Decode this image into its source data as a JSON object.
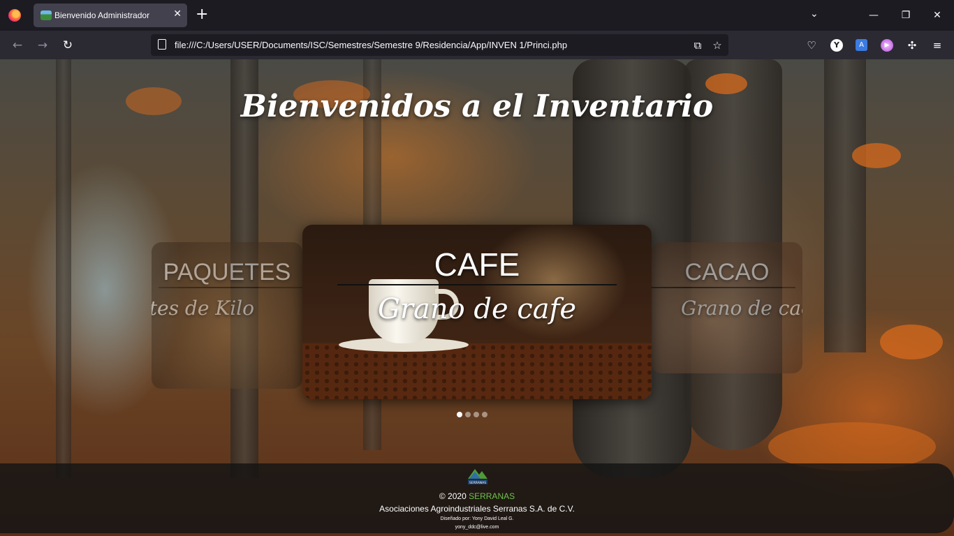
{
  "browser": {
    "tab_title": "Bienvenido Administrador",
    "url": "file:///C:/Users/USER/Documents/ISC/Semestres/Semestre 9/Residencia/App/INVEN 1/Princi.php",
    "icons": {
      "back": "arrow-left-icon",
      "forward": "arrow-right-icon",
      "reload": "reload-icon",
      "pocket": "pocket-icon",
      "extensions": "puzzle-icon",
      "menu": "hamburger-icon"
    }
  },
  "page": {
    "heading": "Bienvenidos a el Inventario",
    "carousel": {
      "slides": [
        {
          "title": "PAQUETES",
          "subtitle": "Paquetes de Kilo"
        },
        {
          "title": "CAFE",
          "subtitle": "Grano de cafe"
        },
        {
          "title": "CACAO",
          "subtitle": "Grano de cacao"
        }
      ],
      "dot_count": 4,
      "active_dot": 0
    }
  },
  "footer": {
    "logo_text": "SERRANAS",
    "copyright_prefix": "© 2020",
    "brand": "SERRANAS",
    "company": "Asociaciones Agroindustriales Serranas S.A. de C.V.",
    "designer": "Diseñado por: Yony David Leal G.",
    "email": "yony_ddc@live.com",
    "brand_color": "#6dc24b"
  }
}
